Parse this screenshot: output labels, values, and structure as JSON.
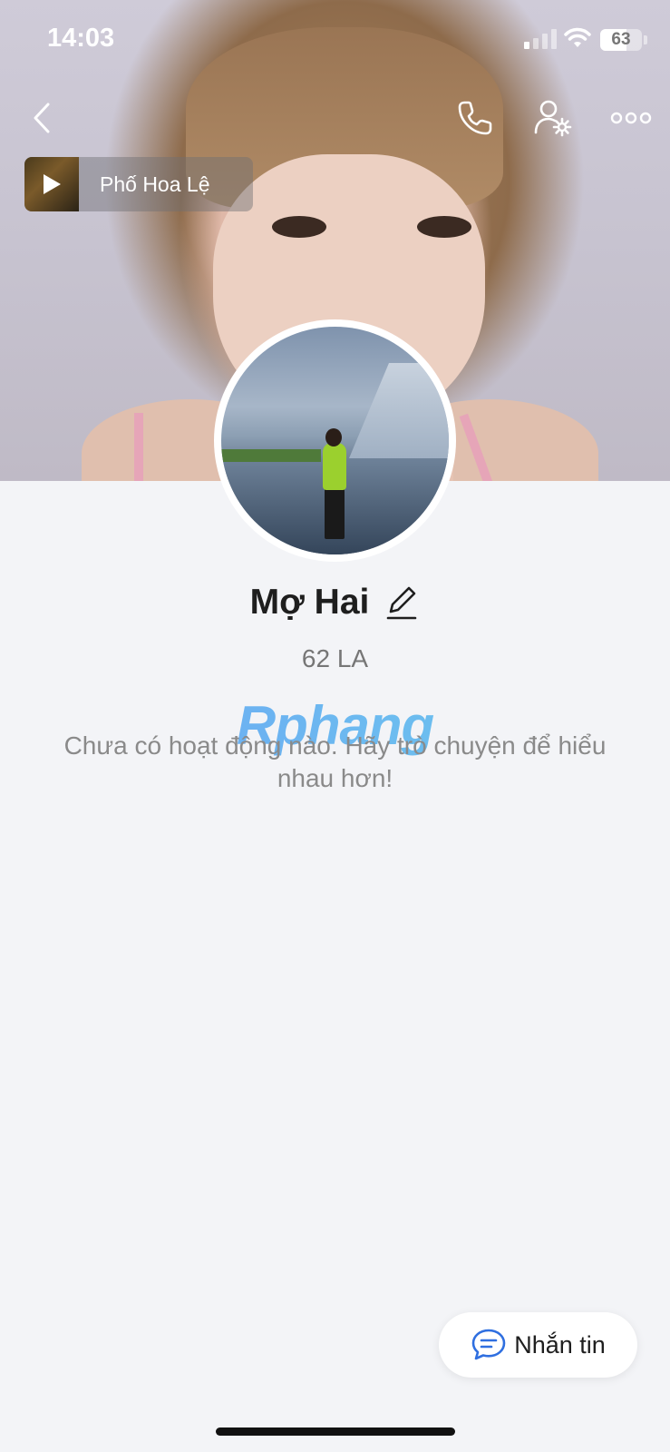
{
  "status_bar": {
    "time": "14:03",
    "battery": "63",
    "battery_level_percent": 63
  },
  "nav": {
    "back_icon": "chevron-left-icon",
    "call_icon": "phone-icon",
    "settings_icon": "user-settings-icon",
    "more_icon": "more-dots-icon"
  },
  "music": {
    "title": "Phố Hoa Lệ",
    "play_icon": "play-icon"
  },
  "profile": {
    "name": "Mợ Hai",
    "subtitle": "62 LA",
    "edit_icon": "pencil-icon"
  },
  "watermark": "Rphang",
  "feed": {
    "empty_message": "Chưa có hoạt động nào. Hãy trò chuyện để hiểu nhau hơn!"
  },
  "actions": {
    "message_label": "Nhắn tin",
    "message_icon": "chat-bubble-icon"
  },
  "colors": {
    "accent": "#2f6fe0",
    "background": "#f3f4f7"
  }
}
